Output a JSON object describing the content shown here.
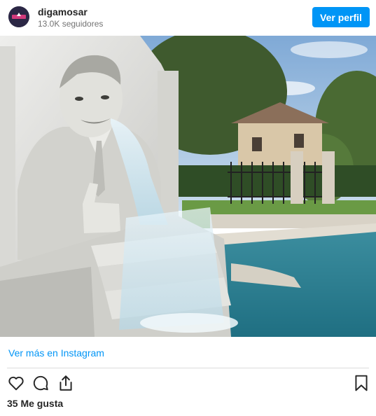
{
  "header": {
    "username": "digamosar",
    "followers": "13.0K seguidores",
    "view_profile_label": "Ver perfil"
  },
  "post": {
    "image_icon": "marble-fountain-photo",
    "more_link": "Ver más en Instagram",
    "likes": "35 Me gusta"
  },
  "icons": [
    "heart-icon",
    "comment-icon",
    "share-icon",
    "bookmark-icon"
  ],
  "colors": {
    "accent": "#0095f6",
    "text": "#262626",
    "muted": "#737373",
    "divider": "#dbdbdb"
  }
}
